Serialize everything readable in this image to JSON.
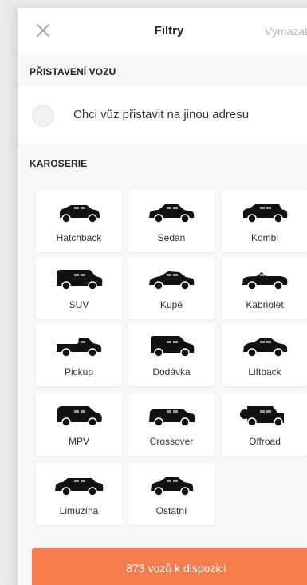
{
  "header": {
    "title": "Filtry",
    "clear_label": "Vymazat"
  },
  "delivery": {
    "section_title": "PŘISTAVENÍ VOZU",
    "option_label": "Chci vůz přistavit na jinou adresu",
    "checked": false
  },
  "body_types": {
    "section_title": "KAROSERIE",
    "items": [
      {
        "label": "Hatchback",
        "icon": "hatchback-car-icon"
      },
      {
        "label": "Sedan",
        "icon": "sedan-car-icon"
      },
      {
        "label": "Kombi",
        "icon": "kombi-car-icon"
      },
      {
        "label": "SUV",
        "icon": "suv-car-icon"
      },
      {
        "label": "Kupé",
        "icon": "coupe-car-icon"
      },
      {
        "label": "Kabriolet",
        "icon": "cabriolet-car-icon"
      },
      {
        "label": "Pickup",
        "icon": "pickup-car-icon"
      },
      {
        "label": "Dodávka",
        "icon": "van-car-icon"
      },
      {
        "label": "Liftback",
        "icon": "liftback-car-icon"
      },
      {
        "label": "MPV",
        "icon": "mpv-car-icon"
      },
      {
        "label": "Crossover",
        "icon": "crossover-car-icon"
      },
      {
        "label": "Offroad",
        "icon": "offroad-car-icon"
      },
      {
        "label": "Limuzína",
        "icon": "limousine-car-icon"
      },
      {
        "label": "Ostatní",
        "icon": "other-car-icon"
      }
    ]
  },
  "cta": {
    "label": "873 vozů k dispozici"
  },
  "colors": {
    "accent": "#f37d4c",
    "muted_text": "#b5b5b5",
    "panel_background": "#f7f7f7",
    "card_background": "#ffffff"
  }
}
